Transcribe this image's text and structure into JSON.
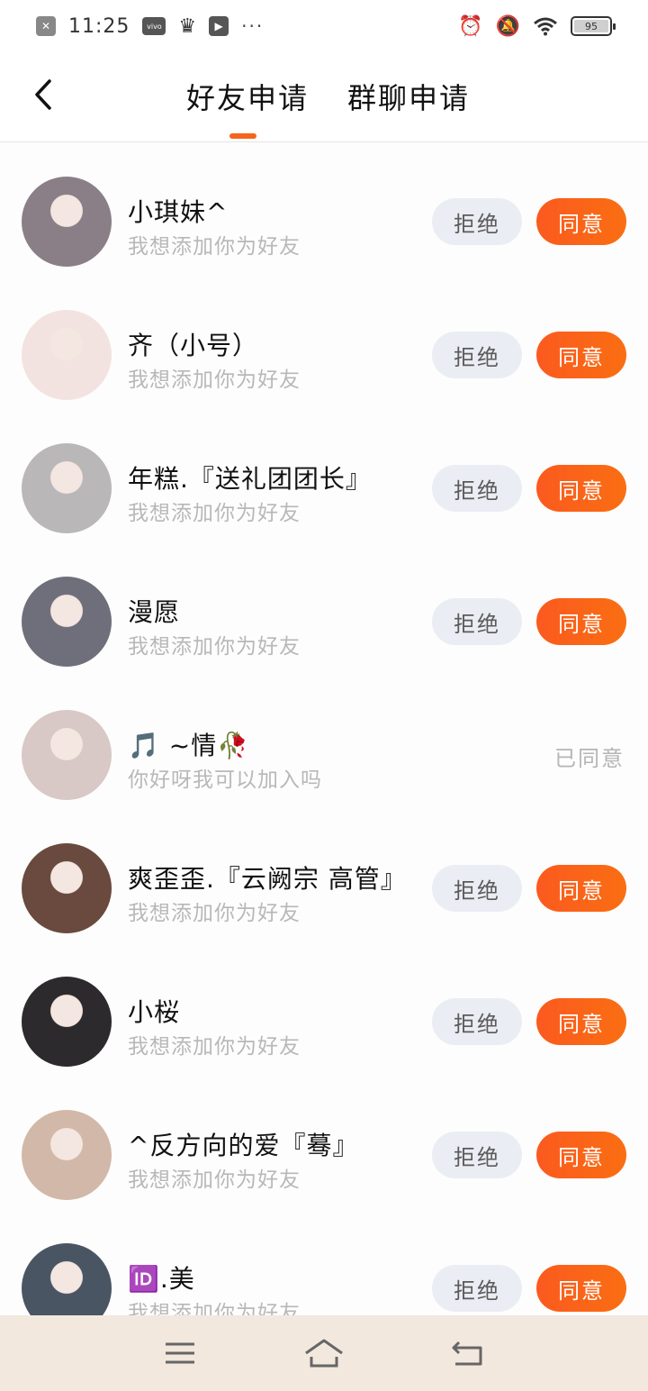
{
  "status_bar": {
    "time": "11:25",
    "battery": "95",
    "left_icons": [
      "x-icon",
      "vivo-icon",
      "crown-icon",
      "play-icon",
      "more-icon"
    ],
    "right_icons": [
      "alarm-icon",
      "mute-icon",
      "wifi-icon",
      "battery-icon"
    ]
  },
  "header": {
    "tabs": [
      {
        "label": "好友申请",
        "active": true
      },
      {
        "label": "群聊申请",
        "active": false
      }
    ]
  },
  "colors": {
    "accent": "#f5651c",
    "reject_bg": "#eaedf3",
    "nav_bg": "#f2e8dd"
  },
  "labels": {
    "reject": "拒绝",
    "accept": "同意"
  },
  "requests": [
    {
      "name": "小琪妹^",
      "message": "我想添加你为好友",
      "status": "pending",
      "avatar_color": "#8a7f86"
    },
    {
      "name": "齐（小号）",
      "message": "我想添加你为好友",
      "status": "pending",
      "avatar_color": "#f3e3e0"
    },
    {
      "name": "年糕.『送礼团团长』",
      "message": "我想添加你为好友",
      "status": "pending",
      "avatar_color": "#b9b7b7"
    },
    {
      "name": "漫愿",
      "message": "我想添加你为好友",
      "status": "pending",
      "avatar_color": "#6f6f7c"
    },
    {
      "name": "🎵 ~情🥀",
      "message": "你好呀我可以加入吗",
      "status": "已同意",
      "avatar_color": "#d8c8c6"
    },
    {
      "name": "爽歪歪.『云阙宗 高管』",
      "message": "我想添加你为好友",
      "status": "pending",
      "avatar_color": "#6a4a3e"
    },
    {
      "name": "小桜",
      "message": "我想添加你为好友",
      "status": "pending",
      "avatar_color": "#2c2a2c"
    },
    {
      "name": "^反方向的爱『蓦』",
      "message": "我想添加你为好友",
      "status": "pending",
      "avatar_color": "#d2b8a8"
    },
    {
      "name": "🆔.美",
      "message": "我想添加你为好友",
      "status": "pending",
      "avatar_color": "#4a5564"
    }
  ],
  "nav_bar": {
    "buttons": [
      "menu-icon",
      "home-icon",
      "back-nav-icon"
    ]
  }
}
